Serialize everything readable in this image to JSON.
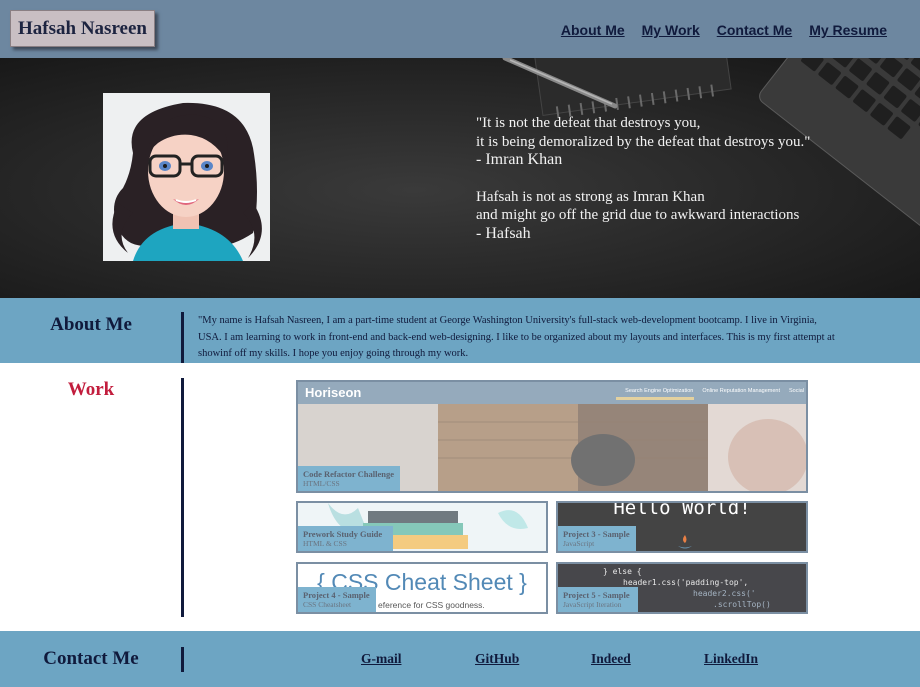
{
  "brand": {
    "name": "Hafsah Nasreen"
  },
  "nav": {
    "items": [
      "About Me",
      "My Work",
      "Contact Me",
      "My Resume"
    ]
  },
  "hero": {
    "quote_lines": [
      "\"It is not the defeat that destroys you,",
      "it is being demoralized by the defeat that destroys you.\"",
      "- Imran Khan",
      "Hafsah is not as strong as Imran Khan",
      "and might go off the grid due to awkward interactions",
      "- Hafsah"
    ]
  },
  "about": {
    "title": "About Me",
    "text": "\"My name is Hafsah Nasreen, I am a part-time student at George Washington University's full-stack web-development bootcamp. I live in Virginia, USA. I am learning to work in front-end and back-end web-designing. I like to be organized about my layouts and interfaces. This is my first attempt at showinf off my skills. I hope you enjoy going through my work."
  },
  "work": {
    "title": "Work",
    "projects": [
      {
        "title": "Code Refactor Challenge",
        "subtitle": "HTML/CSS",
        "thumb": {
          "brand": "Horiseon",
          "menu": [
            "Search Engine Optimization",
            "Online Reputation Management",
            "Social"
          ]
        }
      },
      {
        "title": "Prework Study Guide",
        "subtitle": "HTML & CSS"
      },
      {
        "title": "Project 3 - Sample",
        "subtitle": "JavaScript",
        "thumb": {
          "text": "Hello World!"
        }
      },
      {
        "title": "Project 4 - Sample",
        "subtitle": "CSS Cheatsheet",
        "thumb": {
          "text": "{ CSS Cheat Sheet }",
          "caption": "eference for CSS goodness."
        }
      },
      {
        "title": "Project 5 - Sample",
        "subtitle": "JavaScript Iteration",
        "thumb": {
          "code": [
            "} else {",
            "header1.css('padding-top',",
            "header2.css('",
            ".scrollTop()"
          ]
        }
      }
    ]
  },
  "contact": {
    "title": "Contact Me",
    "links": [
      "G-mail",
      "GitHub",
      "Indeed",
      "LinkedIn"
    ]
  }
}
